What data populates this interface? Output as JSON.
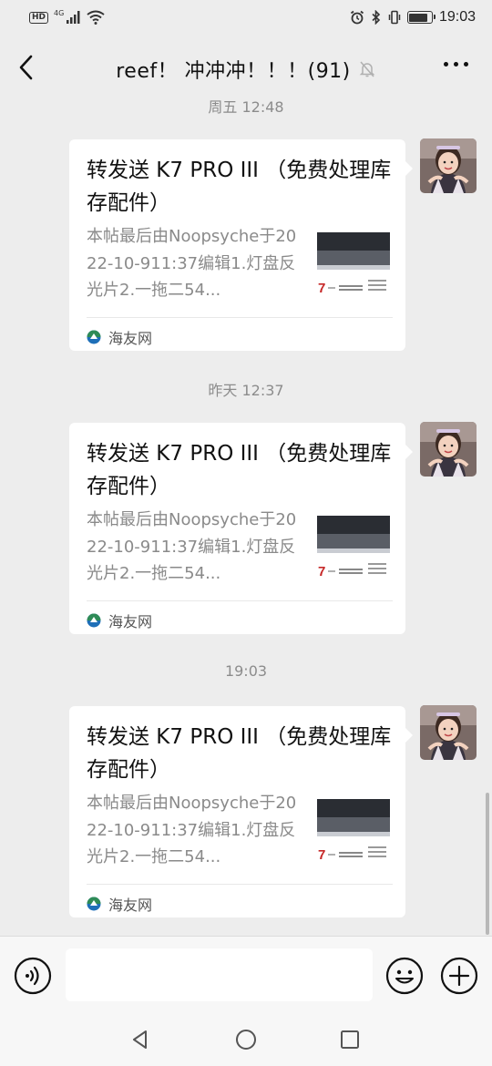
{
  "status_bar": {
    "hd_label": "HD",
    "network_label": "4G",
    "time": "19:03"
  },
  "header": {
    "title": "reef！ 冲冲冲！！！(91)"
  },
  "chat": {
    "messages": [
      {
        "timestamp": "周五 12:48",
        "card_title": "转发送 K7 PRO III （免费处理库存配件）",
        "card_desc": "本帖最后由Noopsyche于2022-10-911:37编辑1.灯盘反光片2.一拖二54...",
        "source": "海友网"
      },
      {
        "timestamp": "昨天 12:37",
        "card_title": "转发送 K7 PRO III （免费处理库存配件）",
        "card_desc": "本帖最后由Noopsyche于2022-10-911:37编辑1.灯盘反光片2.一拖二54...",
        "source": "海友网"
      },
      {
        "timestamp": "19:03",
        "card_title": "转发送 K7 PRO III （免费处理库存配件）",
        "card_desc": "本帖最后由Noopsyche于2022-10-911:37编辑1.灯盘反光片2.一拖二54...",
        "source": "海友网"
      }
    ]
  },
  "input_bar": {
    "text_value": ""
  },
  "icons": {
    "back": "chevron-left-icon",
    "mute": "bell-off-icon",
    "more": "more-dots-icon",
    "voice": "voice-icon",
    "emoji": "smile-icon",
    "plus": "plus-icon",
    "nav_back": "triangle-back-icon",
    "nav_home": "circle-home-icon",
    "nav_recent": "square-recent-icon"
  },
  "colors": {
    "background": "#ededed",
    "card": "#ffffff",
    "timestamp_text": "#8c8c8c",
    "desc_text": "#8a8a8a",
    "source_icon_green": "#2e8b57",
    "source_icon_blue": "#1e6fb8"
  }
}
